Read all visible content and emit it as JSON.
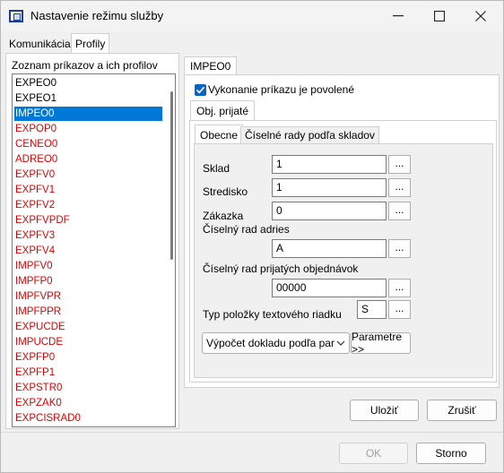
{
  "window": {
    "title": "Nastavenie režimu služby",
    "min_label": "—",
    "close_label": "✕"
  },
  "tabs": [
    {
      "label": "Komunikácia",
      "active": false
    },
    {
      "label": "Profily",
      "active": true
    }
  ],
  "left": {
    "caption": "Zoznam príkazov a ich profilov",
    "items": [
      {
        "label": "EXPEO0",
        "color": "black"
      },
      {
        "label": "EXPEO1",
        "color": "black"
      },
      {
        "label": "IMPEO0",
        "color": "selected"
      },
      {
        "label": "EXPOP0",
        "color": "red"
      },
      {
        "label": "CENEO0",
        "color": "red"
      },
      {
        "label": "ADREO0",
        "color": "red"
      },
      {
        "label": "EXPFV0",
        "color": "red"
      },
      {
        "label": "EXPFV1",
        "color": "red"
      },
      {
        "label": "EXPFV2",
        "color": "red"
      },
      {
        "label": "EXPFVPDF",
        "color": "red"
      },
      {
        "label": "EXPFV3",
        "color": "red"
      },
      {
        "label": "EXPFV4",
        "color": "red"
      },
      {
        "label": "IMPFV0",
        "color": "red"
      },
      {
        "label": "IMPFP0",
        "color": "red"
      },
      {
        "label": "IMPFVPR",
        "color": "red"
      },
      {
        "label": "IMPFPPR",
        "color": "red"
      },
      {
        "label": "EXPUCDE",
        "color": "red"
      },
      {
        "label": "IMPUCDE",
        "color": "red"
      },
      {
        "label": "EXPFP0",
        "color": "red"
      },
      {
        "label": "EXPFP1",
        "color": "red"
      },
      {
        "label": "EXPSTR0",
        "color": "red"
      },
      {
        "label": "EXPZAK0",
        "color": "red"
      },
      {
        "label": "EXPCISRAD0",
        "color": "red"
      }
    ]
  },
  "right": {
    "command_tab": "IMPEO0",
    "enabled_checkbox_label": "Vykonanie príkazu je povolené",
    "enabled_checked": true,
    "sub_tab": "Obj. prijaté",
    "inner_tabs": [
      {
        "label": "Obecne",
        "active": true
      },
      {
        "label": "Číselné rady podľa skladov",
        "active": false
      }
    ],
    "fields": {
      "sklad_label": "Sklad",
      "sklad_value": "1",
      "stredisko_label": "Stredisko",
      "stredisko_value": "1",
      "zakazka_label": "Zákazka",
      "zakazka_value": "0",
      "ciselny_rad_adries_label": "Číselný rad adries",
      "ciselny_rad_adries_value": "A",
      "ciselny_rad_obj_label": "Číselný rad prijatých objednávok",
      "ciselny_rad_obj_value": "00000",
      "typ_polozky_label": "Typ položky textového riadku",
      "typ_polozky_value": "S",
      "ellipsis": "..."
    },
    "combo_value": "Výpočet dokladu podľa par",
    "parametre_button": "Parametre >>"
  },
  "buttons": {
    "ulozit": "Uložiť",
    "zrusit": "Zrušiť",
    "ok": "OK",
    "storno": "Storno"
  }
}
